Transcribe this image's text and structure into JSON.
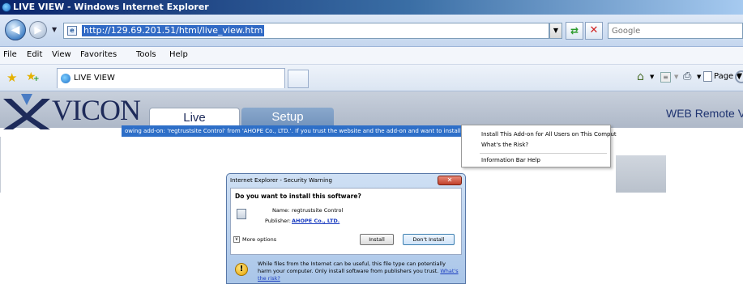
{
  "window": {
    "title": "LIVE VIEW - Windows Internet Explorer"
  },
  "address_bar": {
    "url": "http://129.69.201.51/html/live_view.htm"
  },
  "search": {
    "placeholder": "Google"
  },
  "menu": {
    "items": [
      "File",
      "Edit",
      "View",
      "Favorites",
      "Tools",
      "Help"
    ]
  },
  "tabs": {
    "active_label": "LIVE VIEW"
  },
  "command_bar": {
    "page_label": "Page"
  },
  "site": {
    "logo_text": "VICON",
    "tab_live": "Live",
    "tab_setup": "Setup",
    "header_right": "WEB Remote V"
  },
  "info_bar": {
    "text": "owing add-on: 'regtrustsite Control' from 'AHOPE Co., LTD.'. If you trust the website and the add-on and want to install it, click"
  },
  "context_menu": {
    "items": [
      "Install This Add-on for All Users on This Comput",
      "What's the Risk?",
      "Information Bar Help"
    ]
  },
  "dialog": {
    "title": "Internet Explorer - Security Warning",
    "question": "Do you want to install this software?",
    "name_label": "Name:",
    "name_value": "regtrustsite Control",
    "publisher_label": "Publisher:",
    "publisher_value": "AHOPE Co., LTD.",
    "more_options": "More options",
    "install_button": "Install",
    "dont_install_button": "Don't Install",
    "warning_text": "While files from the Internet can be useful, this file type can potentially harm your computer. Only install software from publishers you trust.",
    "risk_link": "What's the risk?"
  },
  "colors": {
    "title_bar": "#0a246a",
    "info_bar": "#2e6fc8",
    "brand": "#1e2b5a",
    "setup_tab": "#7a9ac4"
  }
}
